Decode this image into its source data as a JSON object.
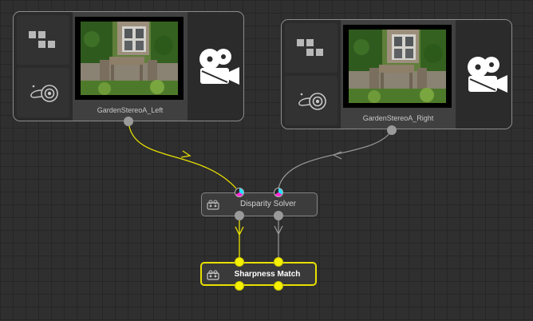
{
  "nodes": {
    "left_read": {
      "name": "GardenStereoA_Left"
    },
    "right_read": {
      "name": "GardenStereoA_Right"
    },
    "disparity": {
      "name": "Disparity Solver"
    },
    "sharpness": {
      "name": "Sharpness Match"
    }
  },
  "colors": {
    "canvas": "#2f2f2f",
    "grid": "#262626",
    "selected_wire": "#e8e000",
    "default_wire": "#9a9a9a"
  },
  "icons": {
    "color_tiles": "color-tiles-icon",
    "target_port": "target-port-icon",
    "movie_camera": "movie-camera-icon",
    "small_camera": "camera-icon"
  }
}
